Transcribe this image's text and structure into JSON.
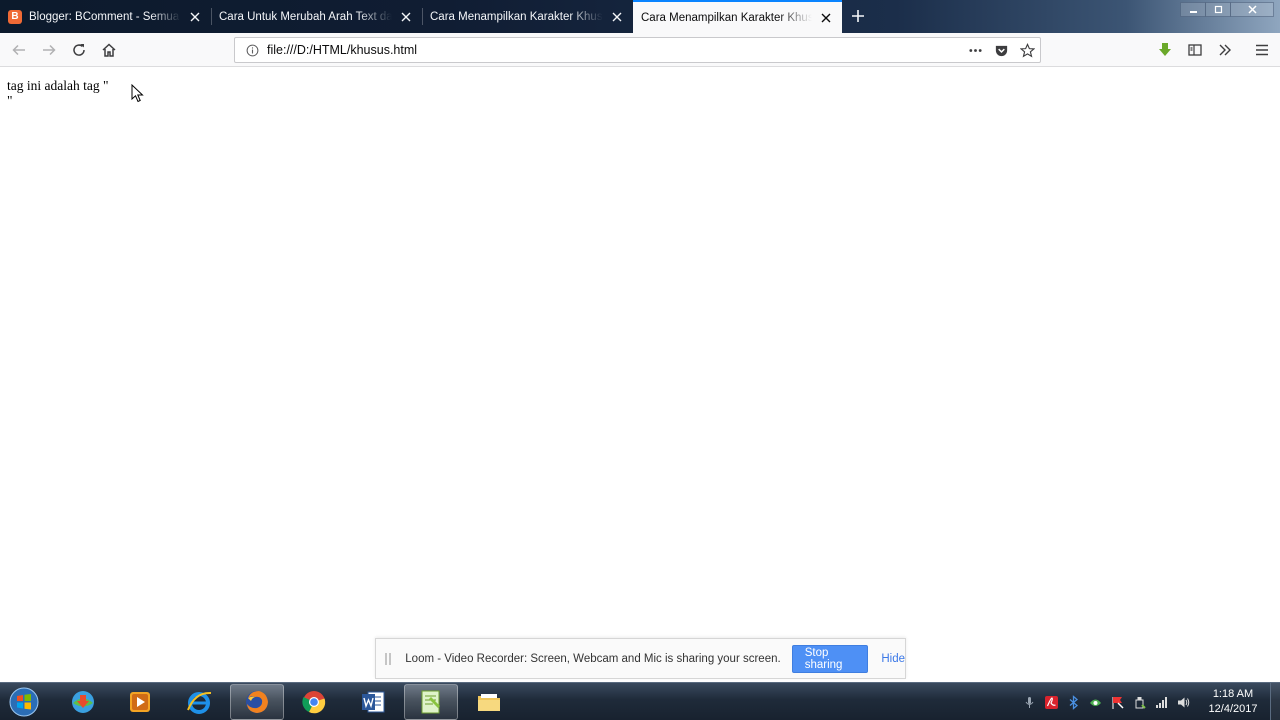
{
  "browser": {
    "tabs": [
      {
        "title": "Blogger: BComment - Semua p",
        "selected": false,
        "favicon": "blogger-icon"
      },
      {
        "title": "Cara Untuk Merubah Arah Text dala",
        "selected": false
      },
      {
        "title": "Cara Menampilkan Karakter Khusus",
        "selected": false
      },
      {
        "title": "Cara Menampilkan Karakter Khusus",
        "selected": true
      }
    ],
    "url": "file:///D:/HTML/khusus.html",
    "accent_color": "#0a84ff"
  },
  "page": {
    "text": "tag ini adalah tag \"\n\""
  },
  "loom": {
    "message": "Loom - Video Recorder: Screen, Webcam and Mic is sharing your screen.",
    "stop_label": "Stop sharing",
    "hide_label": "Hide",
    "button_color": "#4e90f5"
  },
  "taskbar": {
    "apps": [
      "start-orb",
      "internet-download-manager",
      "media-player",
      "internet-explorer",
      "firefox",
      "chrome",
      "word",
      "notepad-plus",
      "file-explorer"
    ],
    "clock": {
      "time": "1:18 AM",
      "date": "12/4/2017"
    }
  }
}
